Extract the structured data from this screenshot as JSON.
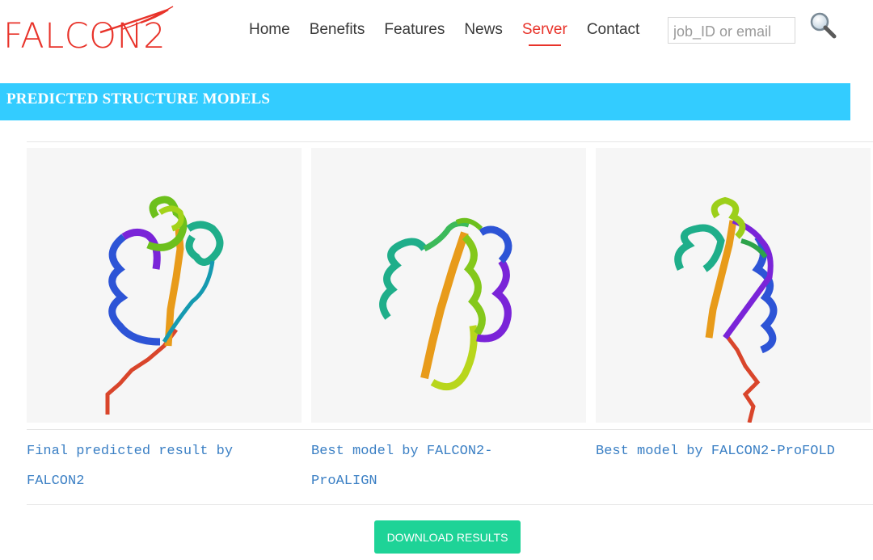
{
  "brand": {
    "logo_text": "FALCON2",
    "accent_color": "#e8332a"
  },
  "nav": {
    "items": [
      {
        "label": "Home"
      },
      {
        "label": "Benefits"
      },
      {
        "label": "Features"
      },
      {
        "label": "News"
      },
      {
        "label": "Server",
        "active": true
      },
      {
        "label": "Contact"
      }
    ],
    "active_color": "#e8332a"
  },
  "search": {
    "placeholder": "job_ID or email",
    "icon": "magnifier-icon"
  },
  "section": {
    "title": "PREDICTED STRUCTURE MODELS",
    "banner_color": "#33ccff"
  },
  "models": [
    {
      "caption": "Final predicted result by FALCON2",
      "image": "protein-ribbon-structure"
    },
    {
      "caption": "Best model by FALCON2-ProALIGN",
      "image": "protein-ribbon-structure"
    },
    {
      "caption": "Best model by FALCON2-ProFOLD",
      "image": "protein-ribbon-structure"
    }
  ],
  "download": {
    "label": "DOWNLOAD RESULTS",
    "color": "#1ed397"
  }
}
